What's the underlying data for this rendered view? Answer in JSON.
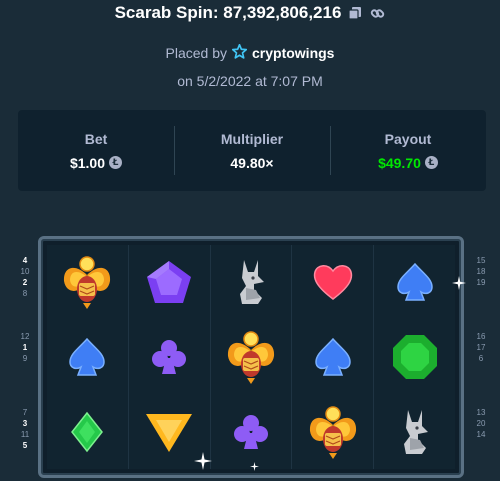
{
  "header": {
    "title": "Scarab Spin: 87,392,806,216",
    "copy_icon": "copy-icon",
    "link_icon": "link-icon"
  },
  "placed": {
    "prefix": "Placed by",
    "badge_icon": "star-badge-icon",
    "username": "cryptowings",
    "date": "on 5/2/2022 at 7:07 PM"
  },
  "stats": {
    "bet_label": "Bet",
    "bet_value": "$1.00",
    "multiplier_label": "Multiplier",
    "multiplier_value": "49.80×",
    "payout_label": "Payout",
    "payout_value": "$49.70",
    "coin_icon": "litecoin-icon",
    "payout_color": "#00e701"
  },
  "reels": [
    [
      "scarab",
      "spade",
      "diamond"
    ],
    [
      "pentagon-gem",
      "club",
      "triangle-gem"
    ],
    [
      "jackal",
      "scarab",
      "club"
    ],
    [
      "heart",
      "spade",
      "scarab"
    ],
    [
      "spade",
      "octagon-gem",
      "jackal"
    ]
  ],
  "side_numbers": {
    "left": [
      [
        "4",
        "10",
        "2",
        "8"
      ],
      [
        "12",
        "1",
        "9"
      ],
      [
        "7",
        "3",
        "11",
        "5"
      ]
    ],
    "left_highlight": [
      "4",
      "2",
      "1",
      "3",
      "5"
    ],
    "right": [
      [
        "15",
        "18",
        "19"
      ],
      [
        "16",
        "17",
        "6"
      ],
      [
        "13",
        "20",
        "14"
      ]
    ]
  }
}
